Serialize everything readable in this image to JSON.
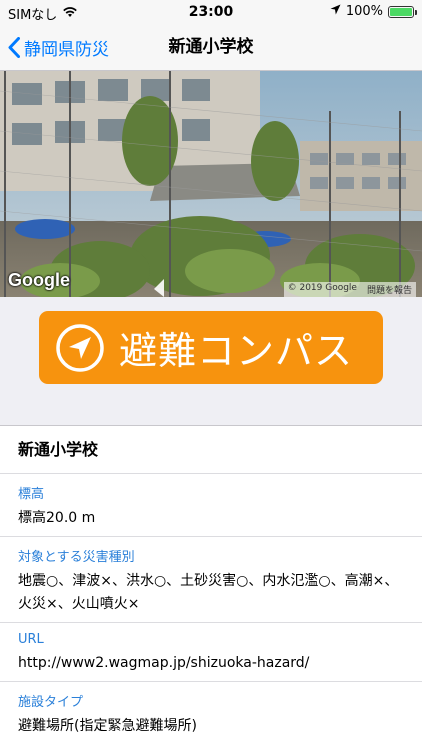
{
  "status_bar": {
    "carrier": "SIMなし",
    "time": "23:00",
    "battery_text": "100%",
    "battery_level": 1.0
  },
  "nav": {
    "back_label": "静岡県防災",
    "title": "新通小学校"
  },
  "street_view": {
    "logo": "Google",
    "copyright": "© 2019 Google",
    "report": "問題を報告"
  },
  "compass_button": {
    "label": "避難コンパス",
    "color": "#f7930e",
    "icon": "navigation-arrow-icon"
  },
  "details": {
    "name": "新通小学校",
    "fields": [
      {
        "label": "標高",
        "value": "標高20.0 m"
      },
      {
        "label": "対象とする災害種別",
        "value": "地震○、津波×、洪水○、土砂災害○、内水氾濫○、高潮×、火災×、火山噴火×"
      },
      {
        "label": "URL",
        "value": "http://www2.wagmap.jp/shizuoka-hazard/"
      },
      {
        "label": "施設タイプ",
        "value": "避難場所(指定緊急避難場所)"
      }
    ]
  },
  "colors": {
    "accent": "#007aff",
    "label_blue": "#2b80d9",
    "button_orange": "#f7930e"
  }
}
